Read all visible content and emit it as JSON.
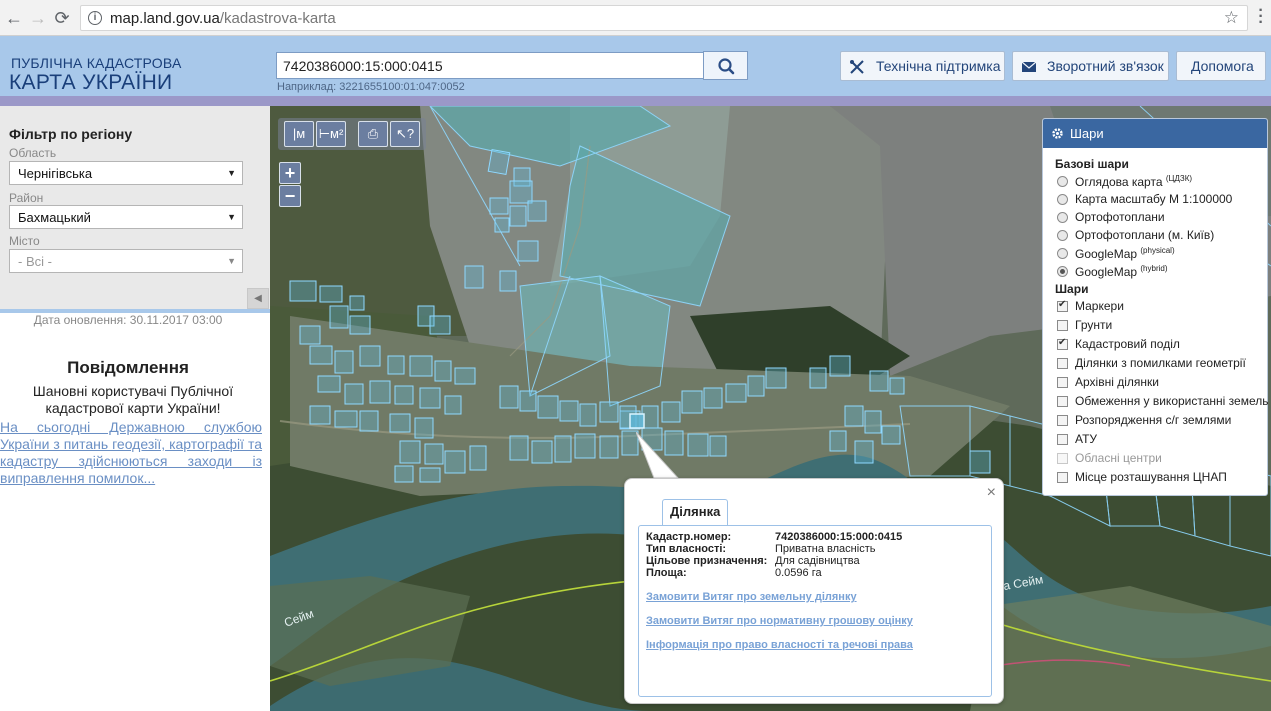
{
  "browser": {
    "url_host": "map.land.gov.ua",
    "url_path": "/kadastrova-karta"
  },
  "header": {
    "logo_top": "ПУБЛІЧНА КАДАСТРОВА",
    "logo_bottom": "КАРТА УКРАЇНИ",
    "search_value": "7420386000:15:000:0415",
    "search_hint": "Наприклад: 3221655100:01:047:0052",
    "buttons": {
      "support": "Технічна підтримка",
      "feedback": "Зворотний зв'язок",
      "help": "Допомога"
    }
  },
  "sidebar": {
    "filter_title": "Фільтр по регіону",
    "oblast_label": "Область",
    "oblast_value": "Чернігівська",
    "raion_label": "Район",
    "raion_value": "Бахмацький",
    "misto_label": "Місто",
    "misto_value": "- Всі -",
    "update_date": "Дата оновлення: 30.11.2017 03:00",
    "notice_title": "Повідомлення",
    "notice_text": "Шановні користувачі Публічної кадастрової карти України!",
    "notice_link": "На сьогодні Державною службою України з питань геодезії, картографії та кадастру здійснюються заходи із виправлення помилок..."
  },
  "map": {
    "tools": {
      "measure_length": "|м",
      "measure_area": "⊢м²",
      "print": "⎙",
      "identify": "↖?"
    },
    "zoom_in": "+",
    "zoom_out": "−",
    "river_labels": [
      "Сейм",
      "Річка Сейм"
    ]
  },
  "layers": {
    "title": "Шари",
    "base_title": "Базові шари",
    "base": [
      {
        "label": "Оглядова карта",
        "sup": "(ЦДЗК)",
        "on": false
      },
      {
        "label": "Карта масштабу М 1:100000",
        "sup": "",
        "on": false
      },
      {
        "label": "Ортофотоплани",
        "sup": "",
        "on": false
      },
      {
        "label": "Ортофотоплани (м. Київ)",
        "sup": "",
        "on": false
      },
      {
        "label": "GoogleMap",
        "sup": "(physical)",
        "on": false
      },
      {
        "label": "GoogleMap",
        "sup": "(hybrid)",
        "on": true
      }
    ],
    "overlays_title": "Шари",
    "overlays": [
      {
        "label": "Маркери",
        "on": true,
        "disabled": false
      },
      {
        "label": "Грунти",
        "on": false,
        "disabled": false
      },
      {
        "label": "Кадастровий поділ",
        "on": true,
        "disabled": false
      },
      {
        "label": "Ділянки з помилками геометрії",
        "on": false,
        "disabled": false
      },
      {
        "label": "Архівні ділянки",
        "on": false,
        "disabled": false
      },
      {
        "label": "Обмеження у використанні земель",
        "on": false,
        "disabled": false
      },
      {
        "label": "Розпорядження с/г землями",
        "on": false,
        "disabled": false
      },
      {
        "label": "АТУ",
        "on": false,
        "disabled": false
      },
      {
        "label": "Обласні центри",
        "on": false,
        "disabled": true
      },
      {
        "label": "Місце розташування ЦНАП",
        "on": false,
        "disabled": false
      }
    ]
  },
  "popup": {
    "close": "×",
    "tab": "Ділянка",
    "rows": [
      {
        "key": "Кадастр.номер:",
        "value": "7420386000:15:000:0415"
      },
      {
        "key": "Тип власності:",
        "value": "Приватна власність"
      },
      {
        "key": "Цільове призначення:",
        "value": "Для садівництва"
      },
      {
        "key": "Площа:",
        "value": "0.0596 га"
      }
    ],
    "links": [
      "Замовити Витяг про земельну ділянку",
      "Замовити Витяг про нормативну грошову оцінку",
      "Інформація про право власності та речові права"
    ]
  },
  "colors": {
    "header_bg": "#a8c8ea",
    "stripe": "#9b98c8",
    "accent": "#3a67a1",
    "link": "#79a2d6",
    "parcel_fill": "#5fb8d8",
    "parcel_stroke": "#8fd8ff"
  }
}
